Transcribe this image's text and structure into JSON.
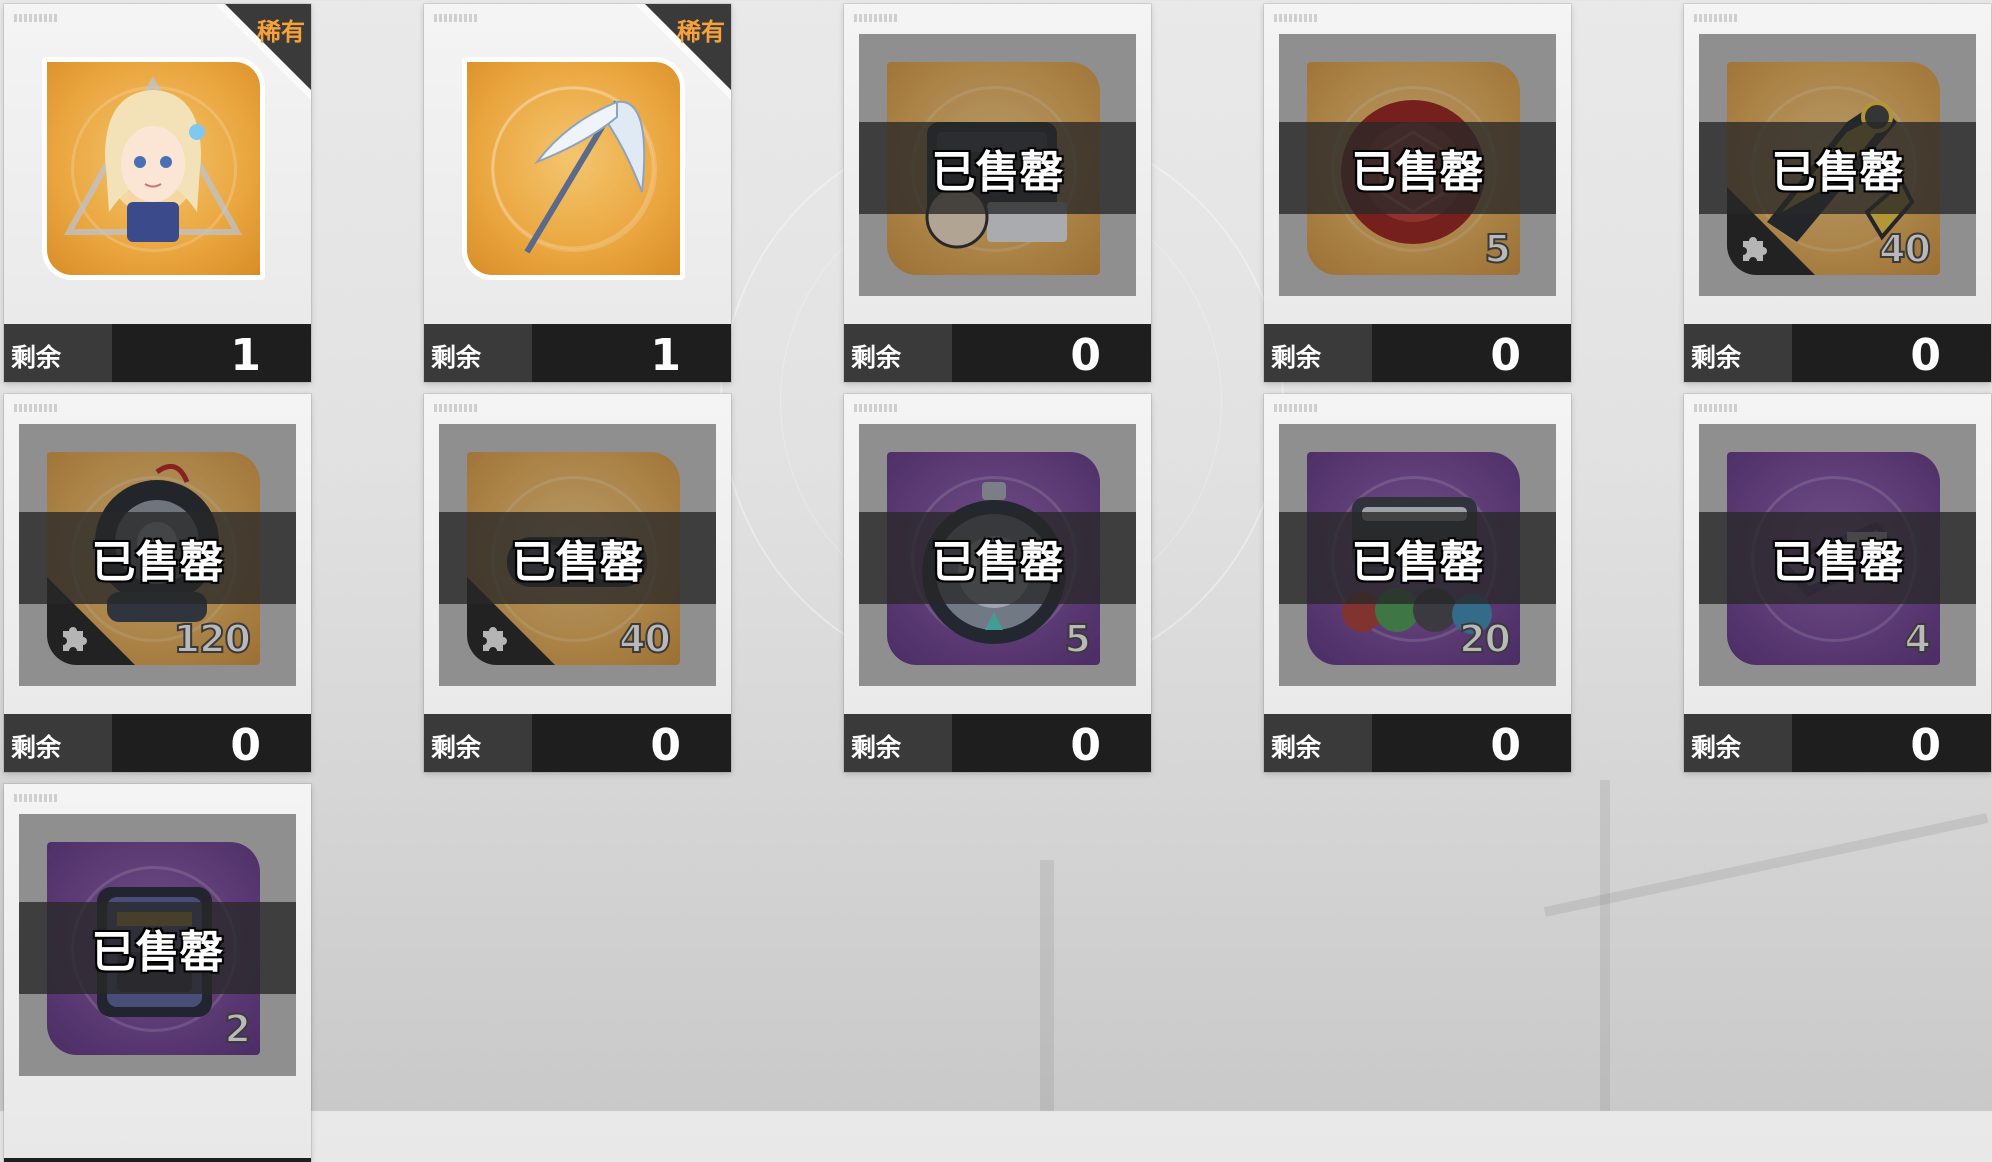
{
  "shop": {
    "remaining_label": "剩余",
    "soldout_label": "已售罄",
    "rare_label": "稀有",
    "items": [
      {
        "name": "character-portrait-item",
        "rare": true,
        "soldout": false,
        "tile": "gold",
        "remaining": "1",
        "qty": "",
        "fragment": false,
        "art": "portrait-icon"
      },
      {
        "name": "weapon-scythe-item",
        "rare": true,
        "soldout": false,
        "tile": "gold",
        "remaining": "1",
        "qty": "",
        "fragment": false,
        "art": "scythe-icon"
      },
      {
        "name": "portrait-box-item",
        "rare": false,
        "soldout": true,
        "tile": "gold",
        "remaining": "0",
        "qty": "",
        "fragment": false,
        "art": "chest-icon"
      },
      {
        "name": "red-orb-item",
        "rare": false,
        "soldout": true,
        "tile": "gold",
        "remaining": "0",
        "qty": "5",
        "fragment": false,
        "art": "red-orb-icon"
      },
      {
        "name": "mech-arm-fragment-item",
        "rare": false,
        "soldout": true,
        "tile": "gold",
        "remaining": "0",
        "qty": "40",
        "fragment": true,
        "art": "mech-arm-icon"
      },
      {
        "name": "gear-device-fragment-item",
        "rare": false,
        "soldout": true,
        "tile": "gold",
        "remaining": "0",
        "qty": "120",
        "fragment": true,
        "art": "gear-device-icon"
      },
      {
        "name": "goggles-fragment-item",
        "rare": false,
        "soldout": true,
        "tile": "gold",
        "remaining": "0",
        "qty": "40",
        "fragment": true,
        "art": "goggles-icon"
      },
      {
        "name": "stopwatch-item",
        "rare": false,
        "soldout": true,
        "tile": "purple",
        "remaining": "0",
        "qty": "5",
        "fragment": false,
        "art": "stopwatch-icon"
      },
      {
        "name": "gem-box-item",
        "rare": false,
        "soldout": true,
        "tile": "purple",
        "remaining": "0",
        "qty": "20",
        "fragment": false,
        "art": "gem-box-icon"
      },
      {
        "name": "purple-device-item",
        "rare": false,
        "soldout": true,
        "tile": "purple",
        "remaining": "0",
        "qty": "4",
        "fragment": false,
        "art": "purple-device-icon"
      },
      {
        "name": "purple-case-item",
        "rare": false,
        "soldout": true,
        "tile": "purple",
        "remaining": "",
        "qty": "2",
        "fragment": false,
        "art": "purple-case-icon"
      }
    ]
  },
  "colors": {
    "gold_tile": "#eaa63f",
    "purple_tile": "#7e45a8",
    "rare_orange": "#f6a13a",
    "footer_dark": "#1e1e1e"
  }
}
